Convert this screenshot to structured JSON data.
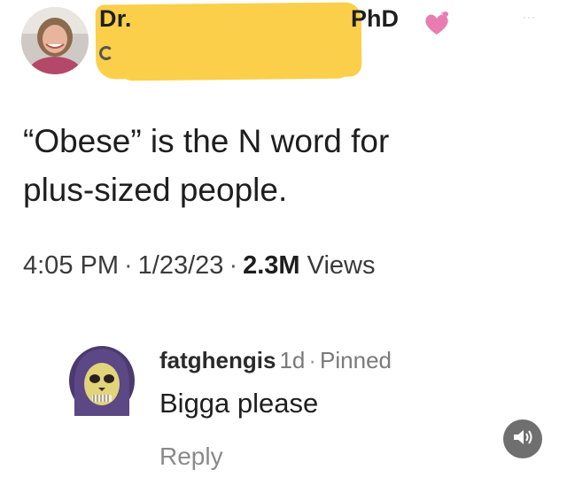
{
  "author": {
    "name_prefix": "Dr.",
    "name_suffix": "PhD",
    "avatar_icon": "person-avatar",
    "badge_icon": "heart-icon",
    "more_icon": "more-icon",
    "more_glyph": "···",
    "redaction_color": "#fbcf4a"
  },
  "tweet": {
    "line1": "“Obese” is the N word for",
    "line2": "plus-sized people.",
    "time": "4:05 PM",
    "date": "1/23/23",
    "views_count": "2.3M",
    "views_label": "Views",
    "separator": "·"
  },
  "comment": {
    "username": "fatghengis",
    "age": "1d",
    "separator": "·",
    "pinned": "Pinned",
    "text": "Bigga please",
    "reply_label": "Reply",
    "avatar_icon": "skull-avatar",
    "sound_icon": "speaker-icon"
  }
}
